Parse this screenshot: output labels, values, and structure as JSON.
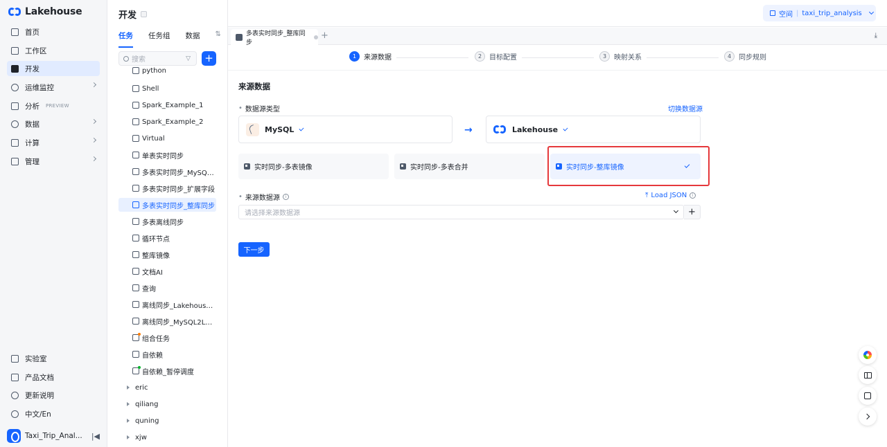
{
  "app": {
    "name": "Lakehouse"
  },
  "nav": {
    "items": [
      {
        "label": "首页",
        "icon": "home-icon"
      },
      {
        "label": "工作区",
        "icon": "cube-icon"
      },
      {
        "label": "开发",
        "icon": "terminal-icon",
        "active": true
      },
      {
        "label": "运维监控",
        "icon": "monitor-icon",
        "expandable": true
      },
      {
        "label": "分析",
        "icon": "chart-icon",
        "badge": "PREVIEW"
      },
      {
        "label": "数据",
        "icon": "database-icon",
        "expandable": true
      },
      {
        "label": "计算",
        "icon": "compute-icon",
        "expandable": true
      },
      {
        "label": "管理",
        "icon": "settings-icon",
        "expandable": true
      }
    ],
    "bottom_items": [
      {
        "label": "实验室",
        "icon": "flask-icon"
      },
      {
        "label": "产品文档",
        "icon": "book-icon"
      },
      {
        "label": "更新说明",
        "icon": "clock-icon"
      },
      {
        "label": "中文/En",
        "icon": "globe-icon"
      }
    ],
    "user": {
      "name": "Taxi_Trip_Anal..."
    }
  },
  "tree": {
    "title": "开发",
    "tabs": [
      "任务",
      "任务组",
      "数据"
    ],
    "active_tab": "任务",
    "search_placeholder": "搜索",
    "add_label": "+",
    "items": [
      {
        "label": "python",
        "code": "Py",
        "type": "file"
      },
      {
        "label": "Shell",
        "code": "Sh",
        "type": "file"
      },
      {
        "label": "Spark_Example_1",
        "code": "Sk",
        "type": "file"
      },
      {
        "label": "Spark_Example_2",
        "code": "Sk",
        "type": "file"
      },
      {
        "label": "Virtual",
        "code": "Vt",
        "type": "file"
      },
      {
        "label": "单表实时同步",
        "code": "RT",
        "type": "file"
      },
      {
        "label": "多表实时同步_MySQL...",
        "code": "RT",
        "type": "file"
      },
      {
        "label": "多表实时同步_扩展字段",
        "code": "RT",
        "type": "file"
      },
      {
        "label": "多表实时同步_整库同步",
        "code": "RT",
        "type": "file",
        "selected": true
      },
      {
        "label": "多表离线同步",
        "code": "OF",
        "type": "file"
      },
      {
        "label": "循环节点",
        "code": "Py",
        "type": "file"
      },
      {
        "label": "整库镜像",
        "code": "Py",
        "type": "file"
      },
      {
        "label": "文档AI",
        "code": "Py",
        "type": "file"
      },
      {
        "label": "查询",
        "code": "Sq",
        "type": "file"
      },
      {
        "label": "离线同步_Lakehouse...",
        "code": "OF",
        "type": "file"
      },
      {
        "label": "离线同步_MySQL2Lak...",
        "code": "OF",
        "type": "file"
      },
      {
        "label": "组合任务",
        "code": "Gp",
        "type": "file",
        "dot": "orange"
      },
      {
        "label": "自依赖",
        "code": "Sq",
        "type": "file"
      },
      {
        "label": "自依赖_暂停调度",
        "code": "Sq",
        "type": "file",
        "dot": "green"
      },
      {
        "label": "eric",
        "type": "folder"
      },
      {
        "label": "qiliang",
        "type": "folder"
      },
      {
        "label": "quning",
        "type": "folder"
      },
      {
        "label": "xjw",
        "type": "folder"
      }
    ]
  },
  "header": {
    "space_label": "空间",
    "space_name": "taxi_trip_analysis"
  },
  "file_tab": {
    "label": "多表实时同步_整库同步",
    "add": "+"
  },
  "steps": [
    {
      "num": "1",
      "label": "来源数据",
      "active": true
    },
    {
      "num": "2",
      "label": "目标配置"
    },
    {
      "num": "3",
      "label": "映射关系"
    },
    {
      "num": "4",
      "label": "同步规则"
    }
  ],
  "form": {
    "section_title": "来源数据",
    "datasource_type_label": "数据源类型",
    "switch_link": "切换数据源",
    "source_db": "MySQL",
    "target_db": "Lakehouse",
    "arrow": "→",
    "modes": [
      {
        "label": "实时同步-多表镜像"
      },
      {
        "label": "实时同步-多表合并"
      },
      {
        "label": "实时同步-整库镜像",
        "selected": true
      }
    ],
    "source_label": "来源数据源",
    "load_json": "Load JSON",
    "select_placeholder": "请选择来源数据源",
    "plus": "+",
    "next_button": "下一步"
  },
  "colors": {
    "accent": "#1664ff",
    "highlight": "#e5383b"
  }
}
